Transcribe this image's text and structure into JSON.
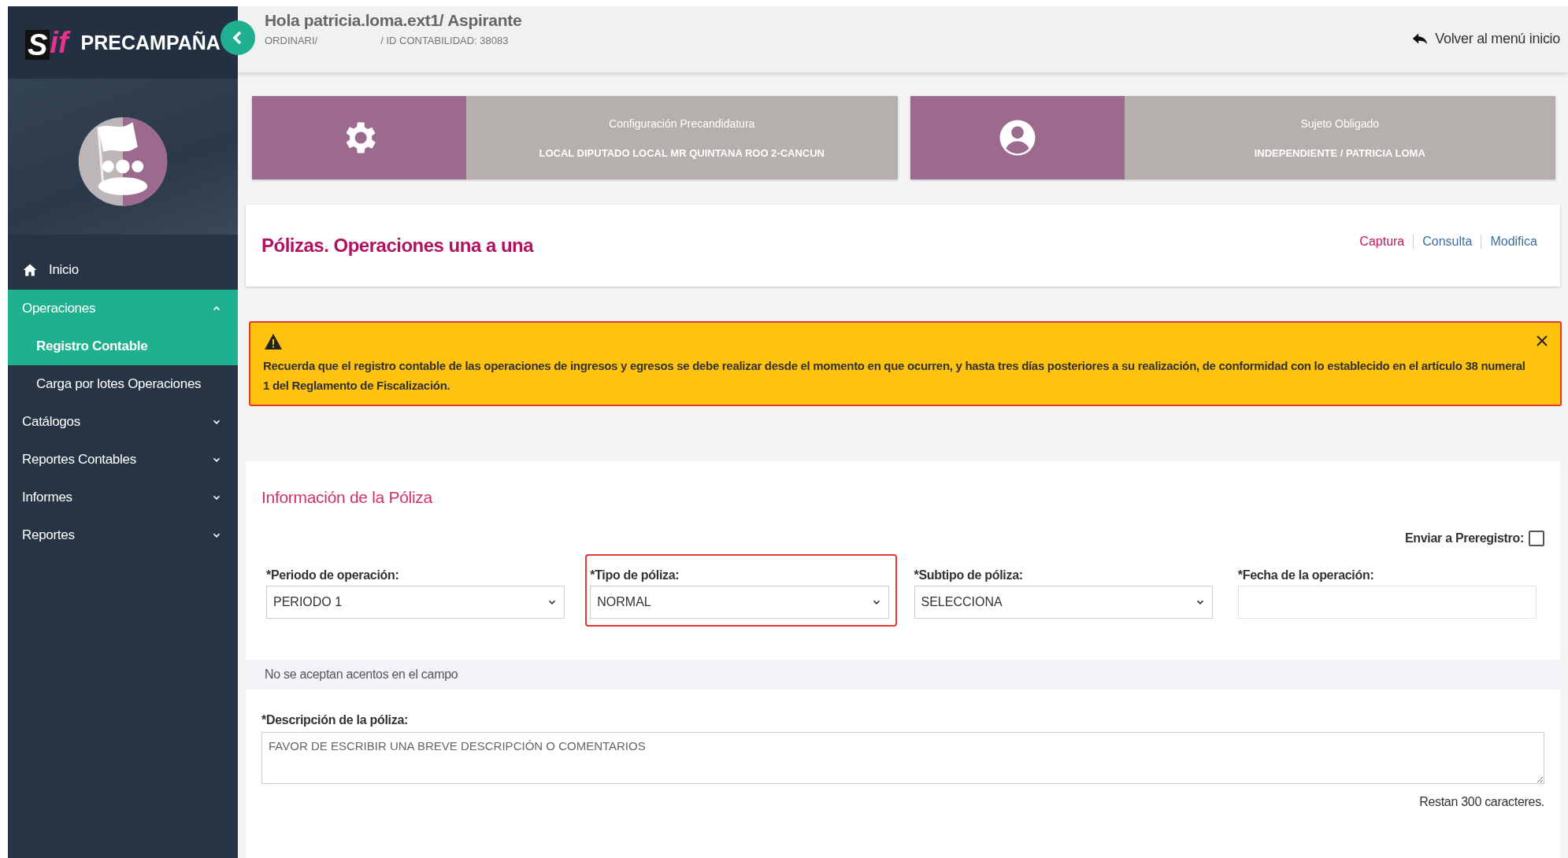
{
  "sidebar": {
    "brand": {
      "logo_left": "S",
      "logo_right": "if",
      "title": "PRECAMPAÑA"
    },
    "items": [
      {
        "label": "Inicio",
        "kind": "home",
        "selected": false
      },
      {
        "label": "Operaciones",
        "kind": "group",
        "expanded": true,
        "children": [
          {
            "label": "Registro Contable",
            "selected": true
          },
          {
            "label": "Carga por lotes Operaciones",
            "selected": false
          }
        ]
      },
      {
        "label": "Catálogos",
        "kind": "group",
        "expanded": false
      },
      {
        "label": "Reportes Contables",
        "kind": "group",
        "expanded": false
      },
      {
        "label": "Informes",
        "kind": "group",
        "expanded": false
      },
      {
        "label": "Reportes",
        "kind": "group",
        "expanded": false
      }
    ]
  },
  "header": {
    "greeting": "Hola patricia.loma.ext1/ Aspirante",
    "subtitle_left": "ORDINARI/",
    "subtitle_right": "/ ID CONTABILIDAD: 38083",
    "back_link": "Volver al menú inicio"
  },
  "info_cards": [
    {
      "kind": "gear",
      "title": "Configuración Precandidatura",
      "value": "LOCAL DIPUTADO LOCAL MR QUINTANA ROO 2-CANCUN"
    },
    {
      "kind": "user",
      "title": "Sujeto Obligado",
      "value": "INDEPENDIENTE / PATRICIA LOMA"
    }
  ],
  "page": {
    "title": "Pólizas. Operaciones una a una",
    "tabs": [
      {
        "label": "Captura",
        "selected": true
      },
      {
        "label": "Consulta",
        "selected": false
      },
      {
        "label": "Modifica",
        "selected": false
      }
    ]
  },
  "alert": {
    "text": "Recuerda que el registro contable de las operaciones de ingresos y egresos se debe realizar desde el momento en que ocurren, y hasta tres días posteriores a su realización, de conformidad con lo establecido en el artículo 38 numeral 1 del Reglamento de Fiscalización."
  },
  "form": {
    "section_title": "Información de la Póliza",
    "preregistro": {
      "label": "Enviar a Preregistro:",
      "checked": false
    },
    "fields": [
      {
        "label": "*Periodo de operación:",
        "kind": "select",
        "value": "PERIODO 1",
        "highlighted": false
      },
      {
        "label": "*Tipo de póliza:",
        "kind": "select",
        "value": "NORMAL",
        "highlighted": true
      },
      {
        "label": "*Subtipo de póliza:",
        "kind": "select",
        "value": "SELECCIONA",
        "highlighted": false
      },
      {
        "label": "*Fecha de la operación:",
        "kind": "text",
        "highlighted": false
      }
    ],
    "note": "No se aceptan acentos en el campo",
    "description": {
      "label": "*Descripción de la póliza:",
      "placeholder": "FAVOR DE ESCRIBIR UNA BREVE DESCRIPCIÓN O COMENTARIOS",
      "counter": "Restan 300 caracteres."
    }
  }
}
